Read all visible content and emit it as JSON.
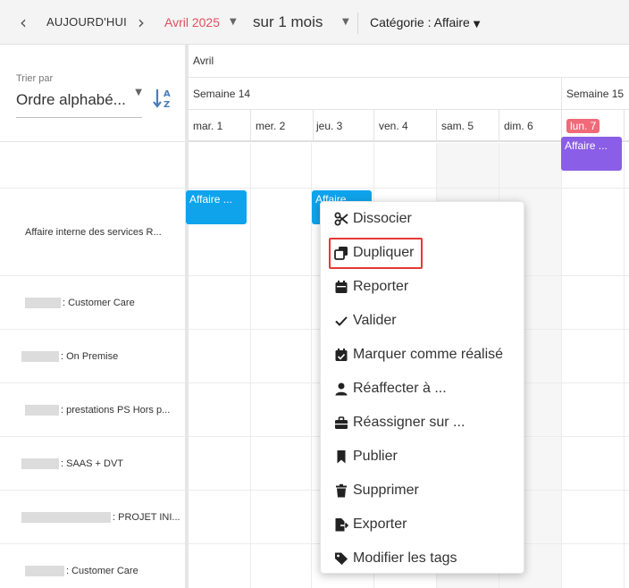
{
  "toolbar": {
    "today_label": "AUJOURD'HUI",
    "month_label": "Avril 2025",
    "period_label": "sur 1 mois",
    "category_label": "Catégorie : Affaire",
    "accent_color": "#e0505f"
  },
  "sort": {
    "label": "Trier par",
    "value": "Ordre alphabé..."
  },
  "header": {
    "month": "Avril",
    "week14": "Semaine 14",
    "week15": "Semaine 15",
    "days": [
      "mar. 1",
      "mer. 2",
      "jeu. 3",
      "ven. 4",
      "sam. 5",
      "dim. 6",
      "lun. 7"
    ]
  },
  "rows": [
    {
      "label": ""
    },
    {
      "label": "Affaire interne des services R..."
    },
    {
      "label": ": Customer Care"
    },
    {
      "label": ": On Premise"
    },
    {
      "label": ": prestations PS Hors p..."
    },
    {
      "label": ": SAAS + DVT"
    },
    {
      "label": ": PROJET INI..."
    },
    {
      "label": ": Customer Care"
    }
  ],
  "events": [
    {
      "label": "Affaire ...",
      "color": "#0fa3ec"
    },
    {
      "label": "Affaire ...",
      "color": "#0fa3ec"
    },
    {
      "label": "Affaire ...",
      "color": "#8a5ee6"
    }
  ],
  "context_menu": {
    "items": [
      {
        "label": "Dissocier",
        "icon": "scissors-icon"
      },
      {
        "label": "Dupliquer",
        "icon": "copy-icon"
      },
      {
        "label": "Reporter",
        "icon": "calendar-icon"
      },
      {
        "label": "Valider",
        "icon": "check-icon"
      },
      {
        "label": "Marquer comme réalisé",
        "icon": "calendar-check-icon"
      },
      {
        "label": "Réaffecter à ...",
        "icon": "user-icon"
      },
      {
        "label": "Réassigner sur ...",
        "icon": "briefcase-icon"
      },
      {
        "label": "Publier",
        "icon": "bookmark-icon"
      },
      {
        "label": "Supprimer",
        "icon": "trash-icon"
      },
      {
        "label": "Exporter",
        "icon": "file-export-icon"
      },
      {
        "label": "Modifier les tags",
        "icon": "tag-icon"
      }
    ],
    "highlighted_item": "Dupliquer",
    "highlight_color": "#e53935"
  }
}
